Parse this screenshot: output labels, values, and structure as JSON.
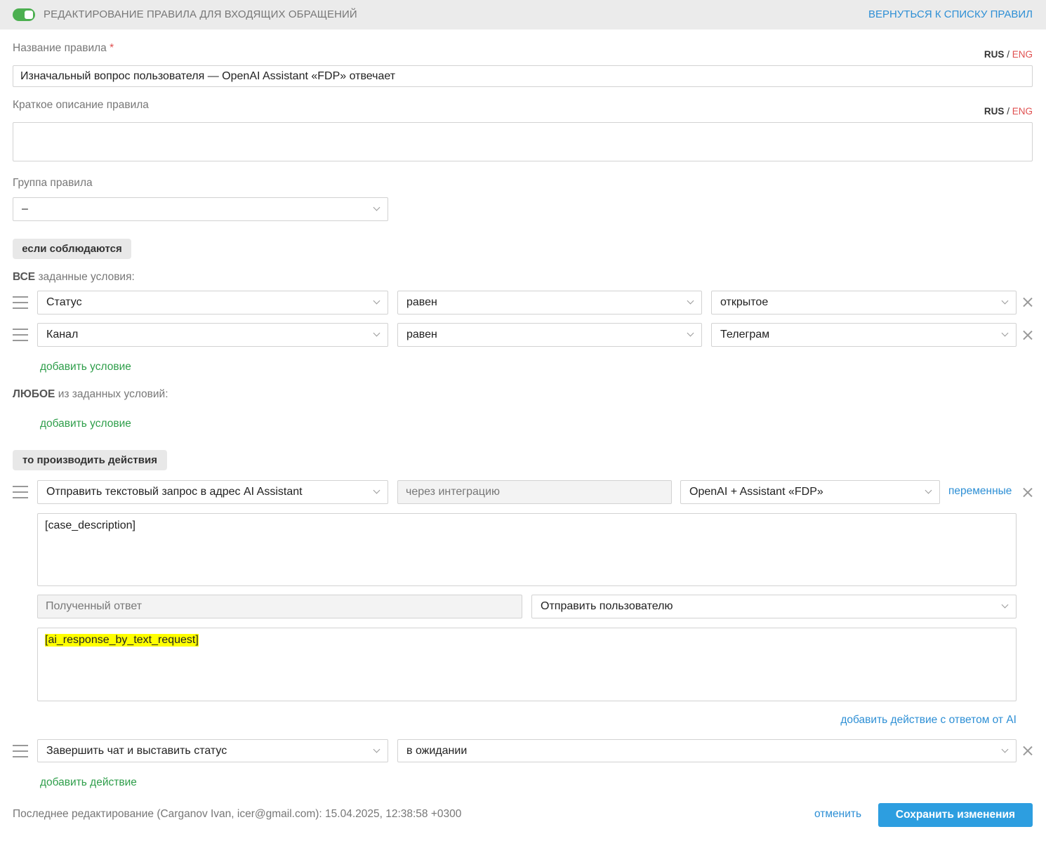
{
  "header": {
    "title": "РЕДАКТИРОВАНИЕ ПРАВИЛА ДЛЯ ВХОДЯЩИХ ОБРАЩЕНИЙ",
    "back_link": "ВЕРНУТЬСЯ К СПИСКУ ПРАВИЛ",
    "toggle_color": "#4caf50"
  },
  "lang_switch": {
    "rus": "RUS",
    "sep": "/",
    "eng": "ENG"
  },
  "rule_name": {
    "label": "Название правила",
    "required_mark": "*",
    "value": "Изначальный вопрос пользователя — OpenAI Assistant «FDP» отвечает"
  },
  "rule_description": {
    "label": "Краткое описание правила",
    "value": ""
  },
  "rule_group": {
    "label": "Группа правила",
    "value": "–"
  },
  "conditions": {
    "section_label": "если соблюдаются",
    "all": {
      "prefix": "ВСЕ",
      "suffix": " заданные условия:",
      "rows": [
        {
          "field": "Статус",
          "operator": "равен",
          "value": "открытое"
        },
        {
          "field": "Канал",
          "operator": "равен",
          "value": "Телеграм"
        }
      ],
      "add_label": "добавить условие"
    },
    "any": {
      "prefix": "ЛЮБОЕ",
      "suffix": " из заданных условий:",
      "add_label": "добавить условие"
    }
  },
  "actions": {
    "section_label": "то производить действия",
    "ai_action": {
      "action": "Отправить текстовый запрос в адрес AI Assistant",
      "via": "через интеграцию",
      "integration": "OpenAI + Assistant «FDP»",
      "variables_link": "переменные",
      "request_text": "[case_description]",
      "response_label": "Полученный ответ",
      "response_target": "Отправить пользователю",
      "response_text": "[ai_response_by_text_request]",
      "add_ai_action_label": "добавить действие с ответом от AI"
    },
    "finish_action": {
      "action": "Завершить чат и выставить статус",
      "status": "в ожидании"
    },
    "add_label": "добавить действие"
  },
  "footer": {
    "last_edit": "Последнее редактирование (Carganov Ivan, icer@gmail.com): 15.04.2025, 12:38:58 +0300",
    "cancel_label": "отменить",
    "save_label": "Сохранить изменения",
    "save_color": "#2d9ee0"
  }
}
